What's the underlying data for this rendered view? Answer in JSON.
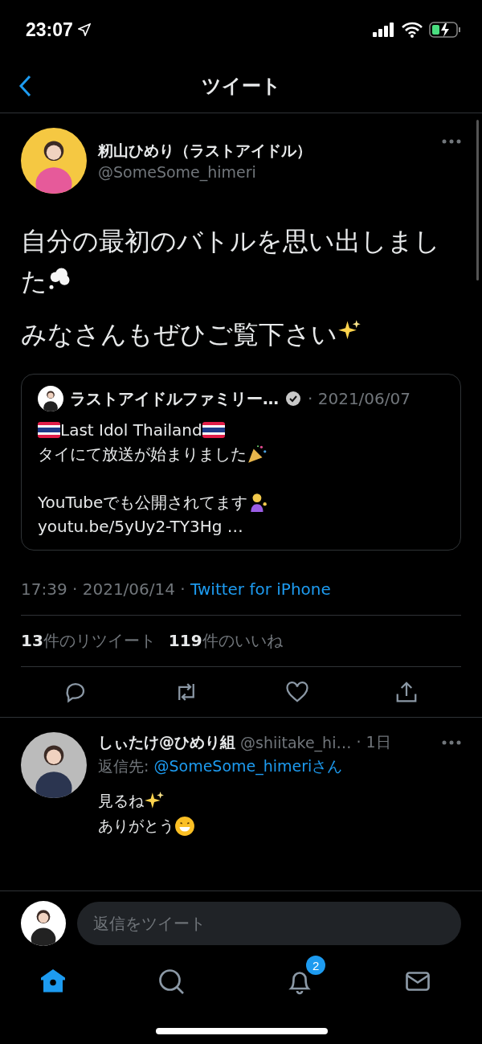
{
  "status_bar": {
    "time": "23:07"
  },
  "header": {
    "title": "ツイート"
  },
  "tweet": {
    "name": "籾山ひめり（ラストアイドル）",
    "handle": "@SomeSome_himeri",
    "paragraphs": [
      {
        "text": "自分の最初のバトルを思い出しました",
        "kind": "thought"
      },
      {
        "text": "みなさんもぜひご覧下さい",
        "kind": "sparkles"
      }
    ],
    "quote": {
      "name": "ラストアイドルファミリー…",
      "verified": true,
      "date": "· 2021/06/07",
      "lines": [
        {
          "text": "Last Idol Thailand",
          "kind": "flags"
        },
        {
          "text": "タイにて放送が始まりました",
          "kind": "party"
        },
        {
          "kind": "blank"
        },
        {
          "text": "YouTubeでも公開されてます",
          "kind": "person"
        },
        {
          "text": "youtu.be/5yUy2-TY3Hg  …",
          "kind": "plain"
        }
      ]
    },
    "time": "17:39 · 2021/06/14 · ",
    "source": "Twitter for iPhone",
    "stats": [
      {
        "count": "13",
        "label": "件のリツイート"
      },
      {
        "count": "119",
        "label": "件のいいね"
      }
    ]
  },
  "reply": {
    "name": "しぃたけ@ひめり組",
    "handle": "@shiitake_hi…",
    "age": "· 1日",
    "reply_to_label": "返信先: ",
    "reply_to": "@SomeSome_himeriさん",
    "lines": [
      {
        "text": "見るね",
        "kind": "sparkles"
      },
      {
        "text": "ありがとう",
        "kind": "grin"
      }
    ]
  },
  "composer": {
    "placeholder": "返信をツイート"
  },
  "tab_bar": [
    {
      "kind": "home",
      "selected": true
    },
    {
      "kind": "search",
      "selected": false
    },
    {
      "kind": "bell",
      "selected": false,
      "badge": "2"
    },
    {
      "kind": "mail",
      "selected": false
    }
  ]
}
